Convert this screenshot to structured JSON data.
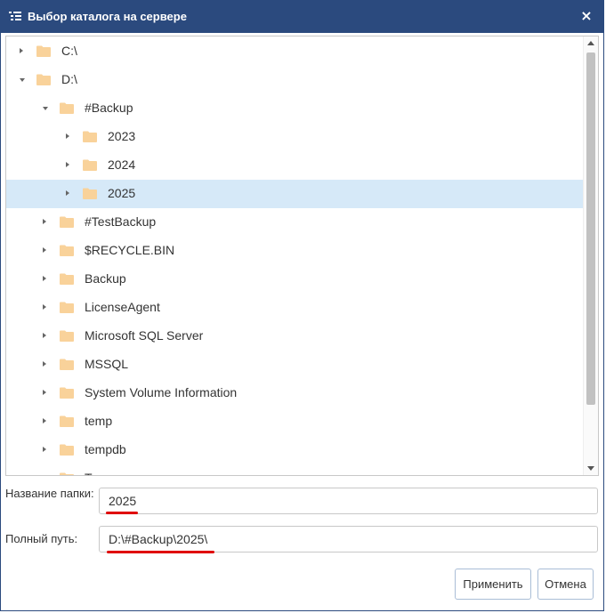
{
  "window": {
    "title": "Выбор каталога на сервере",
    "close_symbol": "×"
  },
  "tree": {
    "items": [
      {
        "label": "C:\\",
        "state": "collapsed",
        "level": 0
      },
      {
        "label": "D:\\",
        "state": "expanded",
        "level": 0
      },
      {
        "label": "#Backup",
        "state": "expanded",
        "level": 1
      },
      {
        "label": "2023",
        "state": "collapsed",
        "level": 2
      },
      {
        "label": "2024",
        "state": "collapsed",
        "level": 2
      },
      {
        "label": "2025",
        "state": "collapsed",
        "level": 2,
        "selected": true
      },
      {
        "label": "#TestBackup",
        "state": "collapsed",
        "level": 1
      },
      {
        "label": "$RECYCLE.BIN",
        "state": "collapsed",
        "level": 1
      },
      {
        "label": "Backup",
        "state": "collapsed",
        "level": 1
      },
      {
        "label": "LicenseAgent",
        "state": "collapsed",
        "level": 1
      },
      {
        "label": "Microsoft SQL Server",
        "state": "collapsed",
        "level": 1
      },
      {
        "label": "MSSQL",
        "state": "collapsed",
        "level": 1
      },
      {
        "label": "System Volume Information",
        "state": "collapsed",
        "level": 1
      },
      {
        "label": "temp",
        "state": "collapsed",
        "level": 1
      },
      {
        "label": "tempdb",
        "state": "collapsed",
        "level": 1
      },
      {
        "label": "T...",
        "state": "collapsed",
        "level": 1
      }
    ]
  },
  "form": {
    "folder_name_label": "Название папки:",
    "folder_name_value": "2025",
    "full_path_label": "Полный путь:",
    "full_path_value": "D:\\#Backup\\2025\\"
  },
  "buttons": {
    "apply": "Применить",
    "cancel": "Отмена"
  },
  "colors": {
    "titlebar": "#2b4a7e",
    "selection": "#d6e9f8",
    "folder": "#f9d29a",
    "annotation_underline": "#e00000"
  }
}
